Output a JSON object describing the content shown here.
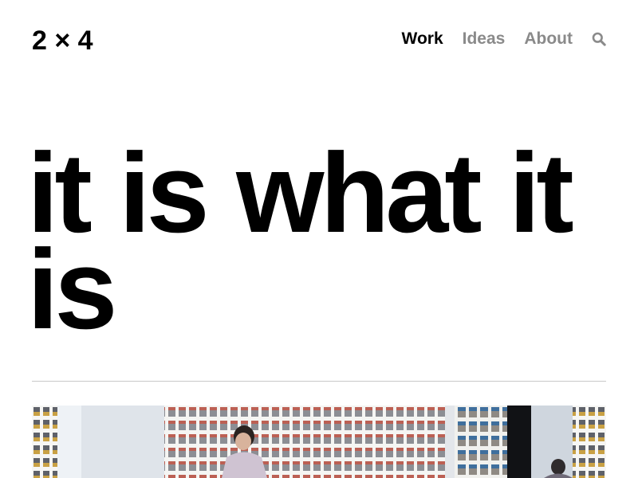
{
  "site": {
    "logo": "2 × 4"
  },
  "nav": {
    "items": [
      {
        "label": "Work",
        "active": true
      },
      {
        "label": "Ideas",
        "active": false
      },
      {
        "label": "About",
        "active": false
      }
    ],
    "search_icon": "search-icon"
  },
  "main": {
    "headline": "it is what it is"
  },
  "colors": {
    "text": "#000000",
    "nav_muted": "#8a8a8a",
    "divider": "#c8c8c8",
    "background": "#ffffff"
  }
}
